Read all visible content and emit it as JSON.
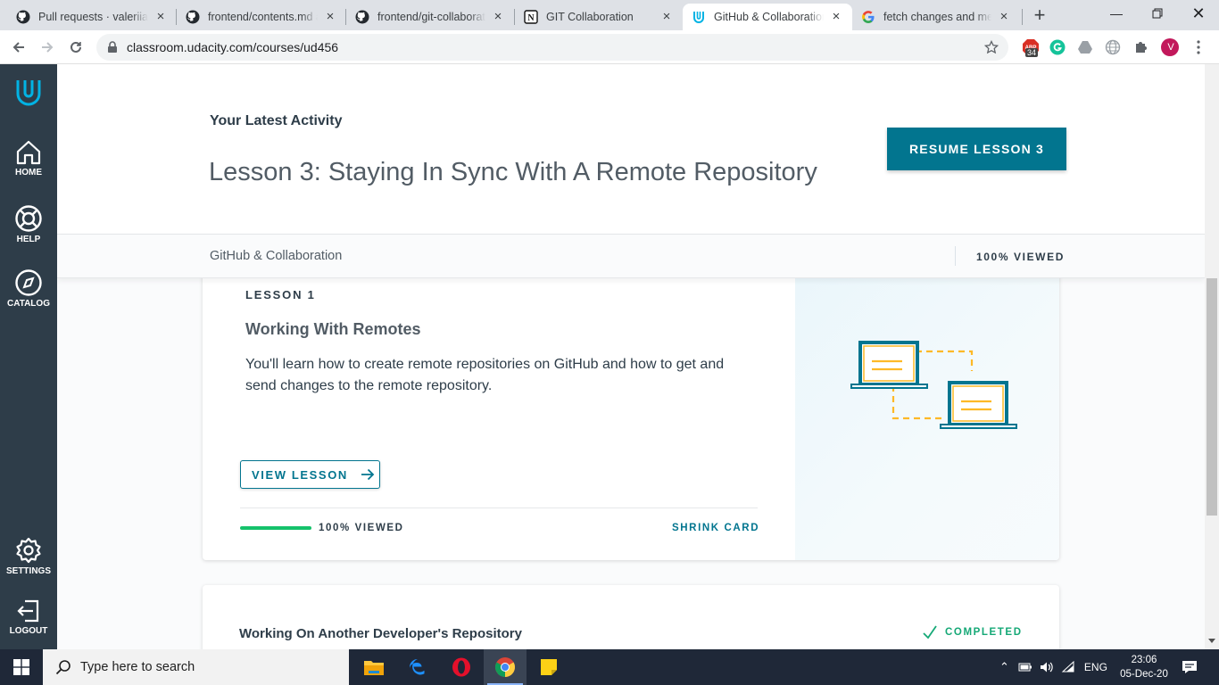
{
  "browser": {
    "tabs": [
      {
        "title": "Pull requests · valeriiahr",
        "icon": "github-icon"
      },
      {
        "title": "frontend/contents.md at",
        "icon": "github-icon"
      },
      {
        "title": "frontend/git-collaborati",
        "icon": "github-icon"
      },
      {
        "title": "GIT Collaboration",
        "icon": "notion-icon"
      },
      {
        "title": "GitHub & Collaboration",
        "icon": "udacity-icon",
        "active": true
      },
      {
        "title": "fetch changes and merg",
        "icon": "google-icon"
      }
    ],
    "url": "classroom.udacity.com/courses/ud456",
    "extension_badge": "34",
    "profile_initial": "V"
  },
  "sidebar": {
    "items": [
      {
        "label": "HOME",
        "icon": "home-icon"
      },
      {
        "label": "HELP",
        "icon": "lifebuoy-icon"
      },
      {
        "label": "CATALOG",
        "icon": "compass-icon"
      },
      {
        "label": "SETTINGS",
        "icon": "gear-icon"
      },
      {
        "label": "LOGOUT",
        "icon": "logout-icon"
      }
    ]
  },
  "hero": {
    "latest_label": "Your Latest Activity",
    "lesson_title": "Lesson 3: Staying In Sync With A Remote Repository",
    "resume_button": "RESUME LESSON 3"
  },
  "course_bar": {
    "course_name": "GitHub & Collaboration",
    "viewed": "100% VIEWED"
  },
  "lessons": [
    {
      "number_label": "LESSON 1",
      "title": "Working With Remotes",
      "description": "You'll learn how to create remote repositories on GitHub and how to get and send changes to the remote repository.",
      "view_button": "VIEW LESSON",
      "progress": 1.0,
      "progress_label": "100% VIEWED",
      "shrink_label": "SHRINK CARD",
      "accent_color": "#15c26b"
    },
    {
      "title": "Working On Another Developer's Repository",
      "status": "COMPLETED"
    }
  ],
  "colors": {
    "udacity_blue": "#02758f",
    "sidebar_bg": "#2e3d49",
    "progress_green": "#15c26b",
    "completed_green": "#15a876"
  },
  "taskbar": {
    "search_placeholder": "Type here to search",
    "apps": [
      "file-explorer-icon",
      "edge-icon",
      "opera-icon",
      "chrome-icon",
      "sticky-notes-icon"
    ],
    "language": "ENG",
    "time": "23:06",
    "date": "05-Dec-20"
  }
}
